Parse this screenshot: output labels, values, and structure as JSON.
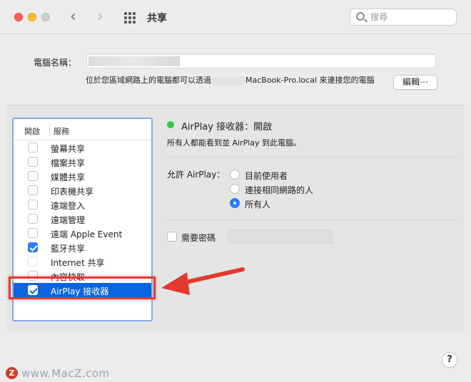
{
  "titlebar": {
    "title": "共享",
    "back_glyph": "‹",
    "forward_glyph": "›",
    "search_placeholder": "搜尋"
  },
  "computer": {
    "name_label": "電腦名稱：",
    "name_value": "",
    "address_prefix": "位於您區域網路上的電腦都可以透過",
    "address_suffix": "MacBook-Pro.local 來連接您的電腦",
    "edit_label": "編輯⋯"
  },
  "services": {
    "header_enable": "開啟",
    "header_service": "服務",
    "items": [
      {
        "label": "螢幕共享",
        "checked": false
      },
      {
        "label": "檔案共享",
        "checked": false
      },
      {
        "label": "媒體共享",
        "checked": false
      },
      {
        "label": "印表機共享",
        "checked": false
      },
      {
        "label": "遠端登入",
        "checked": false
      },
      {
        "label": "遠端管理",
        "checked": false
      },
      {
        "label": "遠端 Apple Event",
        "checked": false
      },
      {
        "label": "藍牙共享",
        "checked": true
      },
      {
        "label": "Internet 共享",
        "checked": false
      },
      {
        "label": "內容快取",
        "checked": false
      },
      {
        "label": "AirPlay 接收器",
        "checked": true,
        "selected": true
      }
    ]
  },
  "detail": {
    "status": "AirPlay 接收器：開啟",
    "status_color": "#2ecc40",
    "description": "所有人都能看到並 AirPlay 到此電腦。",
    "allow_label": "允許 AirPlay：",
    "options": [
      {
        "label": "目前使用者",
        "selected": false
      },
      {
        "label": "連接相同網路的人",
        "selected": false
      },
      {
        "label": "所有人",
        "selected": true
      }
    ],
    "password_label": "需要密碼",
    "password_checked": false
  },
  "help_label": "?",
  "watermark": {
    "logo": "Z",
    "text": "www.MacZ.com"
  },
  "accent_color": "#2b7bf6",
  "annotation_color": "#e23b2e"
}
